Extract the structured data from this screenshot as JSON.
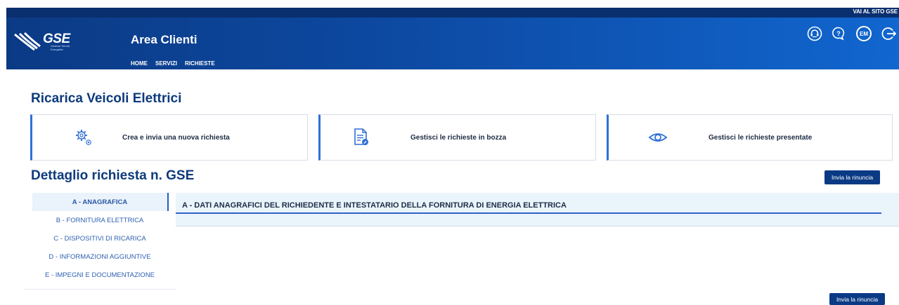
{
  "topbar": {
    "link": "VAI AL SITO GSE"
  },
  "header": {
    "logo": {
      "text": "GSE",
      "subtitle": "Gestore Servizi Energetici"
    },
    "title": "Area Clienti",
    "nav": [
      "HOME",
      "SERVIZI",
      "RICHIESTE"
    ],
    "user_initials": "EM",
    "icons": [
      "support-headset-icon",
      "help-chat-icon",
      "user-avatar",
      "logout-icon"
    ]
  },
  "page": {
    "title": "Ricarica Veicoli Elettrici"
  },
  "cards": [
    {
      "label": "Crea e invia una nuova richiesta",
      "icon": "gears-icon"
    },
    {
      "label": "Gestisci le richieste in bozza",
      "icon": "draft-document-icon"
    },
    {
      "label": "Gestisci le richieste presentate",
      "icon": "eye-icon"
    }
  ],
  "detail": {
    "title": "Dettaglio richiesta n. GSE",
    "button_top": "Invia la rinuncia",
    "button_bottom": "Invia la rinuncia"
  },
  "sidenav": [
    {
      "label": "A - ANAGRAFICA",
      "active": true
    },
    {
      "label": "B - FORNITURA ELETTRICA",
      "active": false
    },
    {
      "label": "C - DISPOSITIVI DI RICARICA",
      "active": false
    },
    {
      "label": "D - INFORMAZIONI AGGIUNTIVE",
      "active": false
    },
    {
      "label": "E - IMPEGNI E DOCUMENTAZIONE",
      "active": false
    }
  ],
  "section": {
    "title": "A - DATI ANAGRAFICI DEL RICHIEDENTE E INTESTATARIO DELLA FORNITURA DI ENERGIA ELETTRICA"
  },
  "colors": {
    "brand_dark": "#0b3a85",
    "brand_light": "#1166cf",
    "accent": "#2f6fd6",
    "panel_bg": "#eaf4fb"
  }
}
